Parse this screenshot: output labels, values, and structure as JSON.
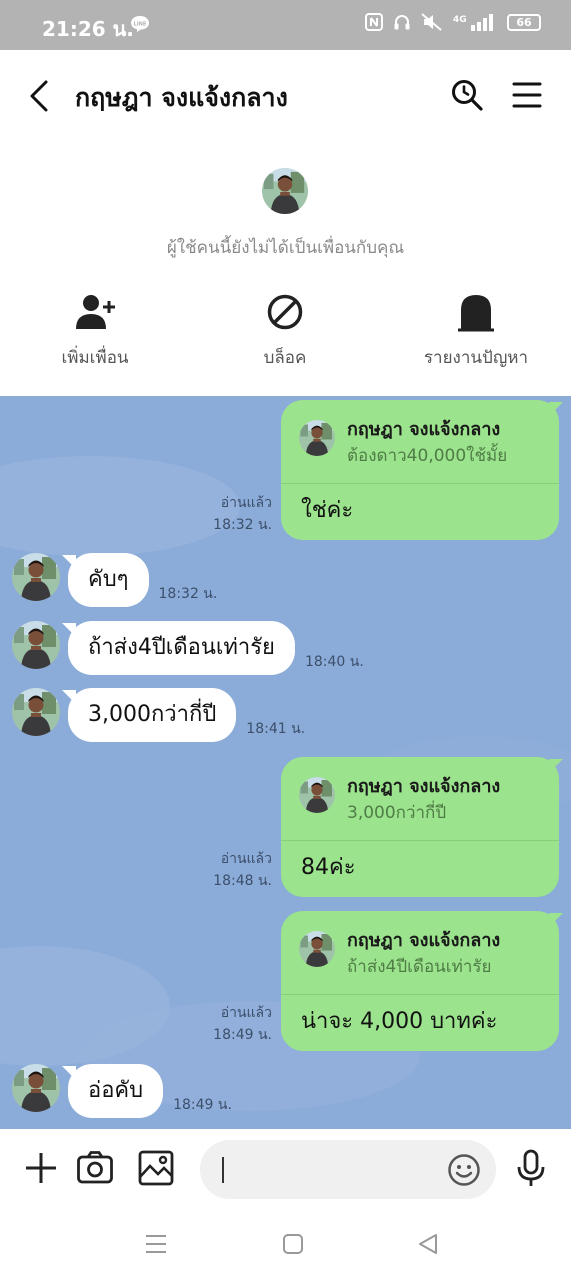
{
  "status_bar": {
    "time": "21:26 น.",
    "network": "4G",
    "battery": "66"
  },
  "header": {
    "title": "กฤษฎา จงแจ้งกลาง"
  },
  "profile": {
    "notice": "ผู้ใช้คนนี้ยังไม่ได้เป็นเพื่อนกับคุณ",
    "actions": [
      {
        "label": "เพิ่มเพื่อน",
        "icon": "add-friend-icon"
      },
      {
        "label": "บล็อค",
        "icon": "block-icon"
      },
      {
        "label": "รายงานปัญหา",
        "icon": "report-icon"
      }
    ]
  },
  "messages": [
    {
      "side": "out",
      "reply_to": {
        "name": "กฤษฎา จงแจ้งกลาง",
        "quote": "ต้องดาว40,000ใช้มั้ย"
      },
      "text": "ใช่ค่ะ",
      "read": "อ่านแล้ว",
      "time": "18:32 น."
    },
    {
      "side": "in",
      "text": "คับๆ",
      "time": "18:32 น."
    },
    {
      "side": "in",
      "text": "ถ้าส่ง4ปีเดือนเท่ารัย",
      "time": "18:40 น."
    },
    {
      "side": "in",
      "text": "3,000กว่ากี่ปี",
      "time": "18:41 น."
    },
    {
      "side": "out",
      "reply_to": {
        "name": "กฤษฎา จงแจ้งกลาง",
        "quote": "3,000กว่ากี่ปี"
      },
      "text": "84ค่ะ",
      "read": "อ่านแล้ว",
      "time": "18:48 น."
    },
    {
      "side": "out",
      "reply_to": {
        "name": "กฤษฎา จงแจ้งกลาง",
        "quote": "ถ้าส่ง4ปีเดือนเท่ารัย"
      },
      "text": "น่าจะ 4,000 บาทค่ะ",
      "read": "อ่านแล้ว",
      "time": "18:49 น."
    },
    {
      "side": "in",
      "text": "อ่อคับ",
      "time": "18:49 น."
    }
  ],
  "input_bar": {
    "value": ""
  },
  "colors": {
    "chat_background": "#8babd8",
    "outgoing_bubble": "#9be38c",
    "incoming_bubble": "#ffffff",
    "status_bar": "#b3b3b3"
  }
}
